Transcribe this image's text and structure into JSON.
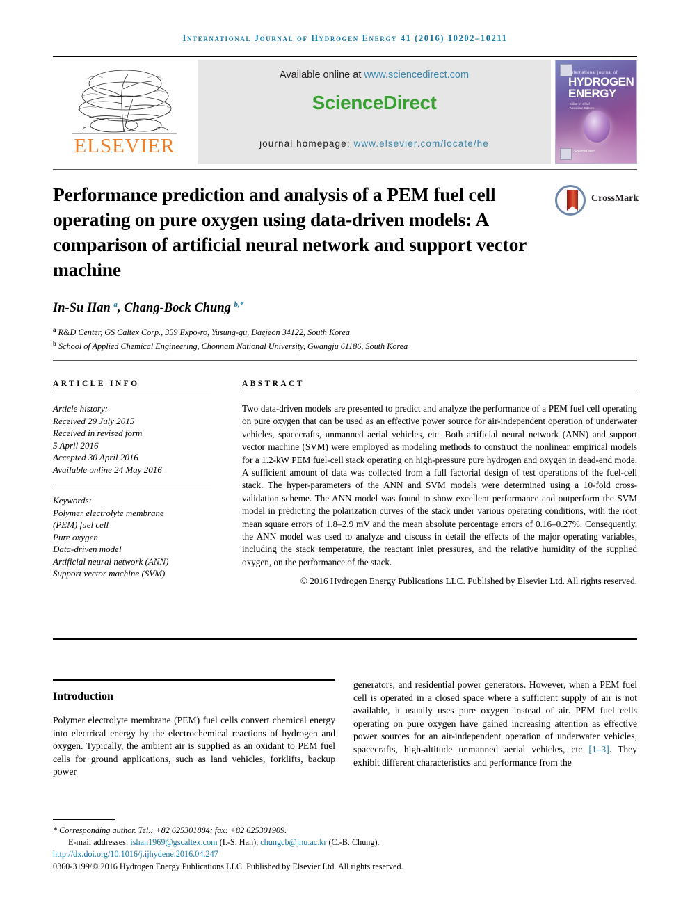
{
  "running_head": "International Journal of Hydrogen Energy 41 (2016) 10202–10211",
  "masthead": {
    "publisher_name": "ELSEVIER",
    "available_prefix": "Available online at ",
    "available_link": "www.sciencedirect.com",
    "sciencedirect_logo": "ScienceDirect",
    "homepage_prefix": "journal homepage: ",
    "homepage_link": "www.elsevier.com/locate/he",
    "cover": {
      "line1": "international journal of",
      "line2": "HYDROGEN\nENERGY",
      "editors": "Editor-in-Chief: T. Nejat Veziroglu\nAssociate Editors: A. Bartels, D.C. Cordon, S.R. Grande,\nM.Z. Hoseino, J.M. Barbo Jr.\nL.N. The, T. and K.C. Vulc-udin",
      "footer": "Published by Elsevier Ltd\nScienceDirect"
    },
    "colors": {
      "link": "#3a87ad",
      "sciencedirect_green": "#3aa033",
      "elsevier_orange": "#F07E26",
      "runhead_blue": "#1279a8"
    }
  },
  "article": {
    "title": "Performance prediction and analysis of a PEM fuel cell operating on pure oxygen using data-driven models: A comparison of artificial neural network and support vector machine",
    "crossmark_label": "CrossMark",
    "authors_html": "In-Su Han <sup>a</sup>, Chang-Bock Chung <sup>b,*</sup>",
    "affiliations": [
      {
        "marker": "a",
        "text": "R&D Center, GS Caltex Corp., 359 Expo-ro, Yusung-gu, Daejeon 34122, South Korea"
      },
      {
        "marker": "b",
        "text": "School of Applied Chemical Engineering, Chonnam National University, Gwangju 61186, South Korea"
      }
    ]
  },
  "article_info": {
    "heading": "Article info",
    "history_label": "Article history:",
    "history": [
      "Received 29 July 2015",
      "Received in revised form",
      "5 April 2016",
      "Accepted 30 April 2016",
      "Available online 24 May 2016"
    ],
    "keywords_label": "Keywords:",
    "keywords": [
      "Polymer electrolyte membrane",
      "(PEM) fuel cell",
      "Pure oxygen",
      "Data-driven model",
      "Artificial neural network (ANN)",
      "Support vector machine (SVM)"
    ]
  },
  "abstract": {
    "heading": "Abstract",
    "text": "Two data-driven models are presented to predict and analyze the performance of a PEM fuel cell operating on pure oxygen that can be used as an effective power source for air-independent operation of underwater vehicles, spacecrafts, unmanned aerial vehicles, etc. Both artificial neural network (ANN) and support vector machine (SVM) were employed as modeling methods to construct the nonlinear empirical models for a 1.2-kW PEM fuel-cell stack operating on high-pressure pure hydrogen and oxygen in dead-end mode. A sufficient amount of data was collected from a full factorial design of test operations of the fuel-cell stack. The hyper-parameters of the ANN and SVM models were determined using a 10-fold cross-validation scheme. The ANN model was found to show excellent performance and outperform the SVM model in predicting the polarization curves of the stack under various operating conditions, with the root mean square errors of 1.8–2.9 mV and the mean absolute percentage errors of 0.16–0.27%. Consequently, the ANN model was used to analyze and discuss in detail the effects of the major operating variables, including the stack temperature, the reactant inlet pressures, and the relative humidity of the supplied oxygen, on the performance of the stack.",
    "copyright": "© 2016 Hydrogen Energy Publications LLC. Published by Elsevier Ltd. All rights reserved."
  },
  "body": {
    "intro_heading": "Introduction",
    "left_paragraph": "Polymer electrolyte membrane (PEM) fuel cells convert chemical energy into electrical energy by the electrochemical reactions of hydrogen and oxygen. Typically, the ambient air is supplied as an oxidant to PEM fuel cells for ground applications, such as land vehicles, forklifts, backup power",
    "right_paragraph_pre": "generators, and residential power generators. However, when a PEM fuel cell is operated in a closed space where a sufficient supply of air is not available, it usually uses pure oxygen instead of air. PEM fuel cells operating on pure oxygen have gained increasing attention as effective power sources for an air-independent operation of underwater vehicles, spacecrafts, high-altitude unmanned aerial vehicles, etc ",
    "right_citation": "[1–3]",
    "right_paragraph_post": ". They exhibit different characteristics and performance from the"
  },
  "footnote": {
    "corresponding": "* Corresponding author. Tel.: +82 625301884; fax: +82 625301909.",
    "email_label": "E-mail addresses: ",
    "email1": "ishan1969@gscaltex.com",
    "email1_name": " (I.-S. Han), ",
    "email2": "chungcb@jnu.ac.kr",
    "email2_name": " (C.-B. Chung).",
    "doi": "http://dx.doi.org/10.1016/j.ijhydene.2016.04.247",
    "issn_line": "0360-3199/© 2016 Hydrogen Energy Publications LLC. Published by Elsevier Ltd. All rights reserved."
  }
}
